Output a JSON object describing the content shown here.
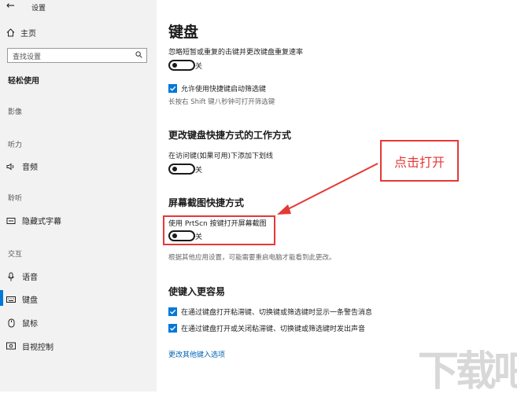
{
  "window": {
    "title": "设置",
    "back_glyph": "←"
  },
  "sidebar": {
    "home_label": "主页",
    "search_placeholder": "查找设置",
    "section_title": "轻松使用",
    "groups": [
      {
        "label": "影像"
      },
      {
        "label": "听力",
        "items": [
          {
            "label": "音频"
          },
          {
            "label": "隐藏式字幕"
          }
        ]
      },
      {
        "label": "聆听"
      },
      {
        "label": "交互",
        "items": [
          {
            "label": "语音"
          },
          {
            "label": "键盘"
          },
          {
            "label": "鼠标"
          },
          {
            "label": "目视控制"
          }
        ]
      }
    ],
    "active_item": "键盘",
    "accent_color": "#0078d7"
  },
  "main": {
    "page_title": "键盘",
    "filter_keys": {
      "description": "忽略短暂或重复的击键并更改键盘重复速率",
      "toggle_state": "关",
      "checkbox_label": "允许使用快捷键启动筛选键",
      "checkbox_checked": true,
      "hint": "长按右 Shift 键八秒钟可打开筛选键"
    },
    "shortcut_section": {
      "title": "更改键盘快捷方式的工作方式",
      "description": "在访问键(如果可用)下添加下划线",
      "toggle_state": "关"
    },
    "print_screen_section": {
      "title": "屏幕截图快捷方式",
      "description": "使用 PrtScn 按键打开屏幕截图",
      "toggle_state": "关",
      "note": "根据其他应用设置，可能需要重启电脑才能看到此更改。"
    },
    "typing_section": {
      "title": "使键入更容易",
      "checkbox1_label": "在通过键盘打开粘滞键、切换键或筛选键时显示一条警告消息",
      "checkbox2_label": "在通过键盘打开或关闭粘滞键、切换键或筛选键时发出声音",
      "checkbox1_checked": true,
      "checkbox2_checked": true,
      "link": "更改其他键入选项"
    }
  },
  "annotation": {
    "text": "点击打开",
    "color": "#e53935"
  },
  "watermark": {
    "text": "下载吧"
  }
}
